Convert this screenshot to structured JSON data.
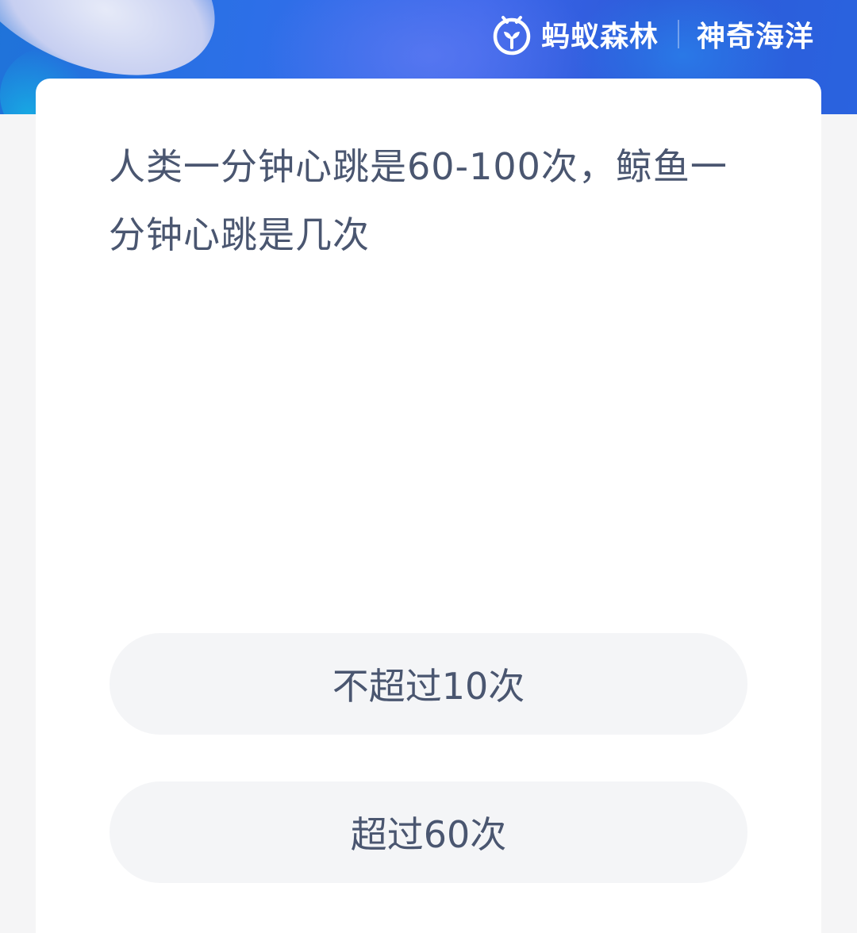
{
  "header": {
    "brand_name": "蚂蚁森林",
    "brand_sub": "神奇海洋",
    "logo_icon": "ant-forest-sprout-logo",
    "colors": {
      "banner_primary": "#2d6fe8",
      "banner_text": "#ffffff"
    }
  },
  "quiz": {
    "question": "人类一分钟心跳是60-100次，鲸鱼一分钟心跳是几次",
    "options": [
      {
        "label": "不超过10次"
      },
      {
        "label": "超过60次"
      }
    ],
    "colors": {
      "text": "#4a5670",
      "option_bg": "#f4f5f7",
      "card_bg": "#ffffff"
    }
  }
}
